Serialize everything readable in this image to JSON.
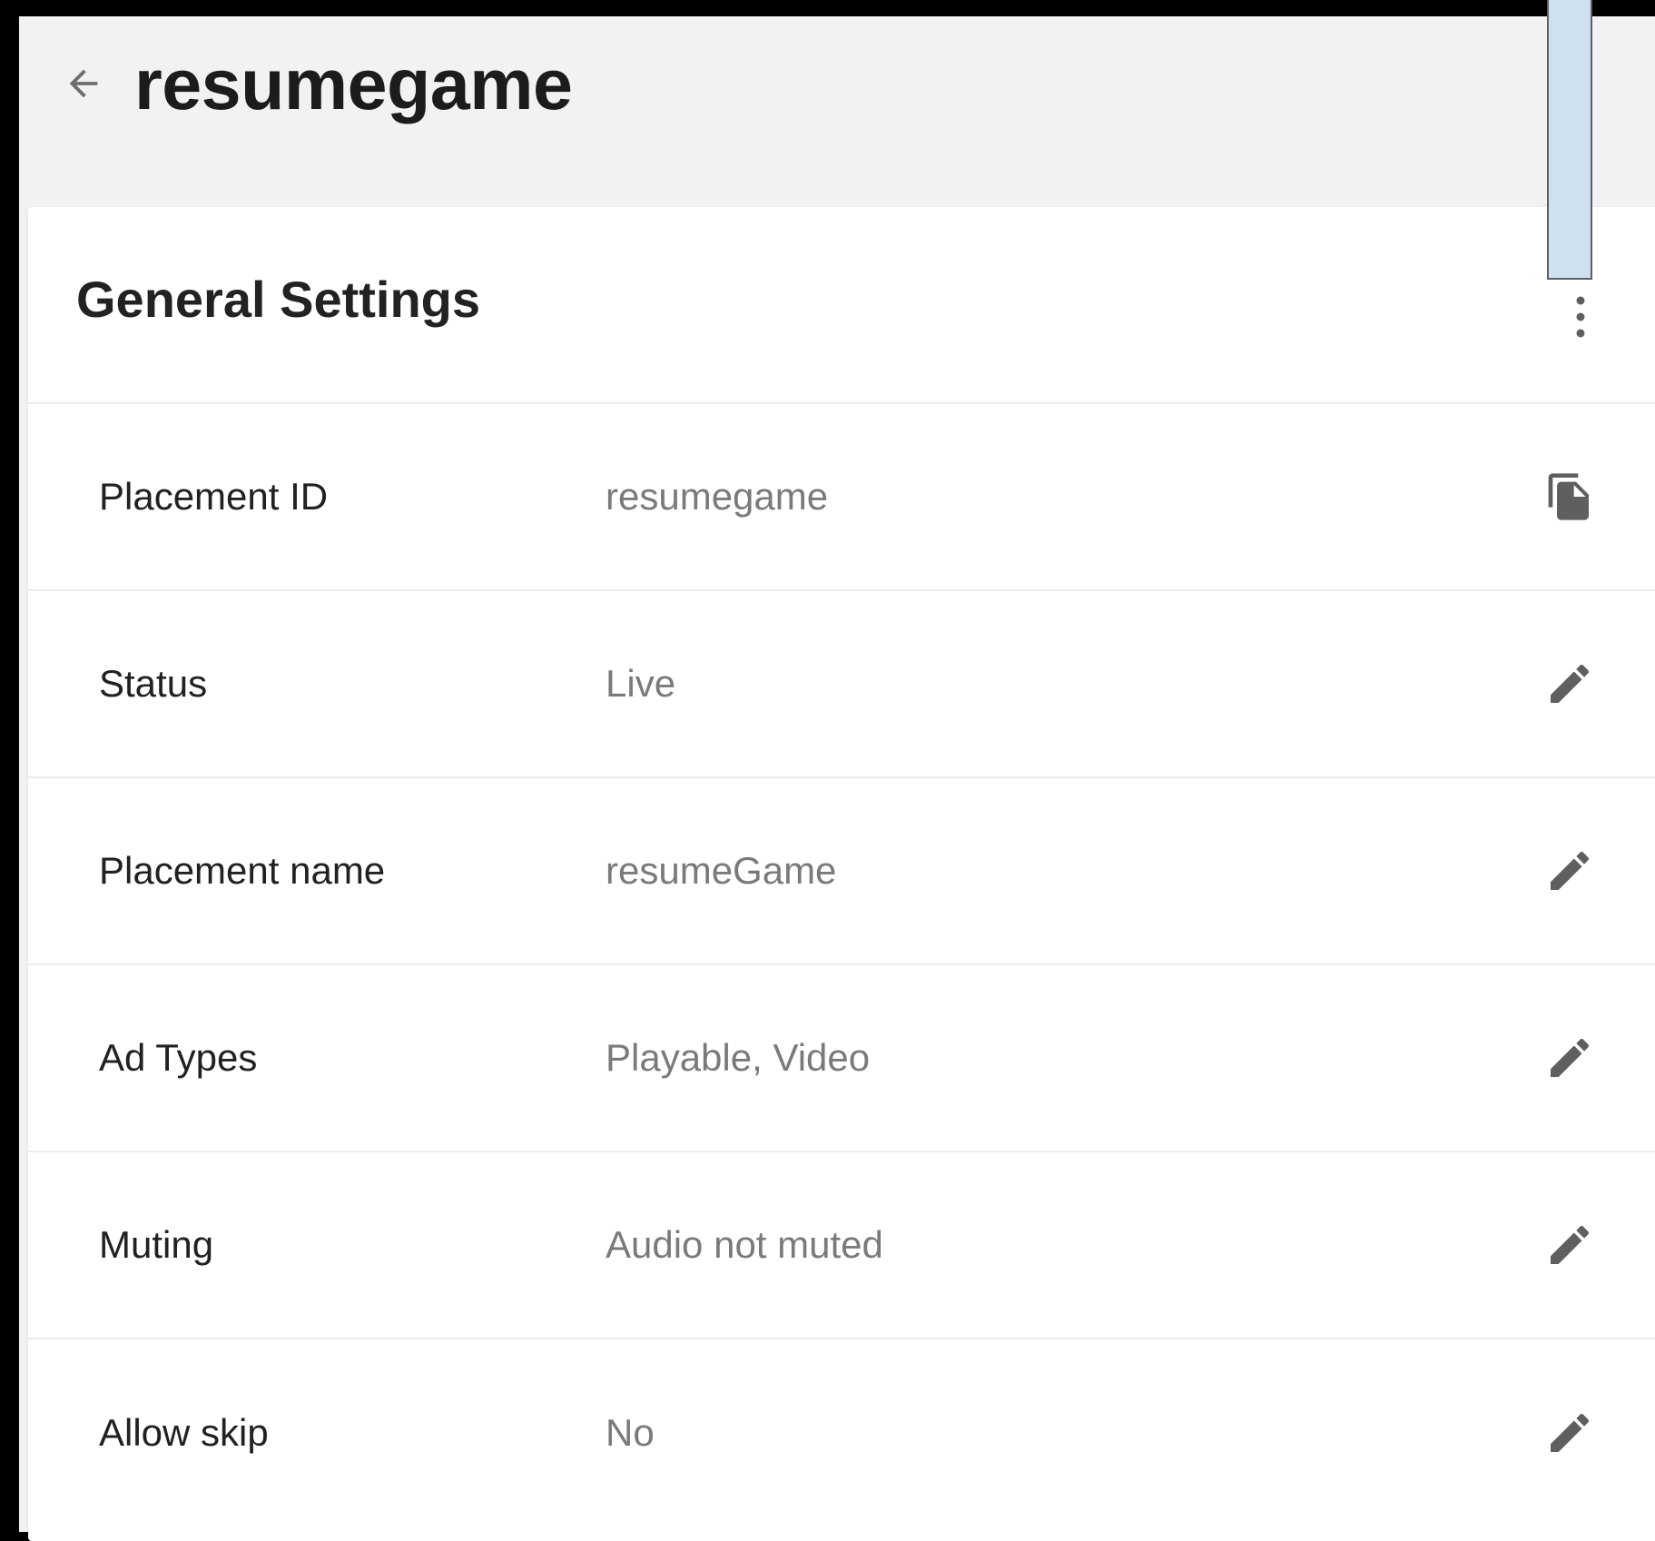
{
  "header": {
    "title": "resumegame",
    "back_icon": "arrow-back-icon"
  },
  "card": {
    "title": "General Settings",
    "more_icon": "more-vert-icon"
  },
  "rows": [
    {
      "label": "Placement ID",
      "value": "resumegame",
      "action_icon": "copy-icon"
    },
    {
      "label": "Status",
      "value": "Live",
      "action_icon": "edit-icon"
    },
    {
      "label": "Placement name",
      "value": "resumeGame",
      "action_icon": "edit-icon"
    },
    {
      "label": "Ad Types",
      "value": "Playable, Video",
      "action_icon": "edit-icon"
    },
    {
      "label": "Muting",
      "value": "Audio not muted",
      "action_icon": "edit-icon"
    },
    {
      "label": "Allow skip",
      "value": "No",
      "action_icon": "edit-icon"
    }
  ],
  "colors": {
    "background": "#f1f2f4",
    "card": "#ffffff",
    "label_text": "#212121",
    "value_text": "#7a7a7a",
    "icon": "#5f5f5f",
    "scroll_handle": "#cfe0f1"
  }
}
